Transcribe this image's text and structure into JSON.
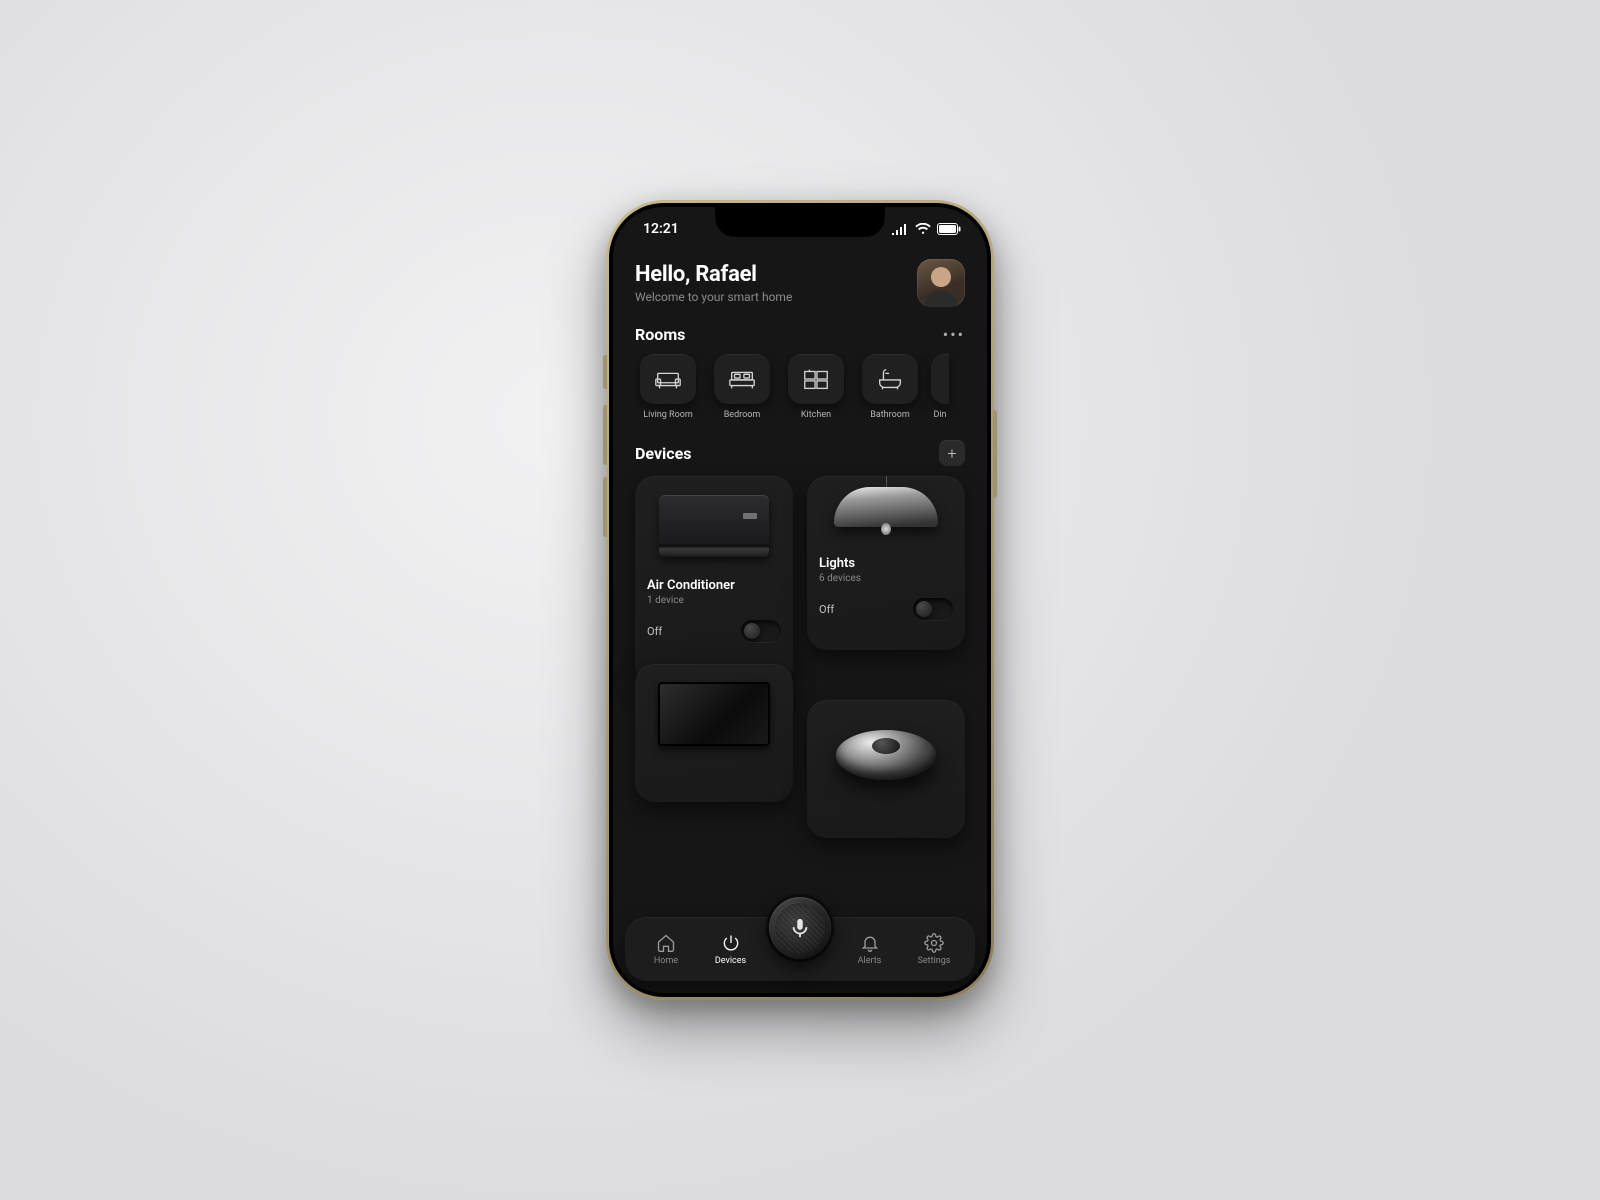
{
  "status": {
    "time": "12:21"
  },
  "header": {
    "greeting": "Hello, Rafael",
    "subtitle": "Welcome to your smart home"
  },
  "rooms": {
    "title": "Rooms",
    "items": [
      {
        "label": "Living Room"
      },
      {
        "label": "Bedroom"
      },
      {
        "label": "Kitchen"
      },
      {
        "label": "Bathroom"
      },
      {
        "label": "Din"
      }
    ]
  },
  "devices": {
    "title": "Devices",
    "cards": [
      {
        "name": "Air Conditioner",
        "sub": "1 device",
        "state": "Off"
      },
      {
        "name": "Lights",
        "sub": "6 devices",
        "state": "Off"
      }
    ]
  },
  "tabs": {
    "home": "Home",
    "devices": "Devices",
    "alerts": "Alerts",
    "settings": "Settings"
  }
}
